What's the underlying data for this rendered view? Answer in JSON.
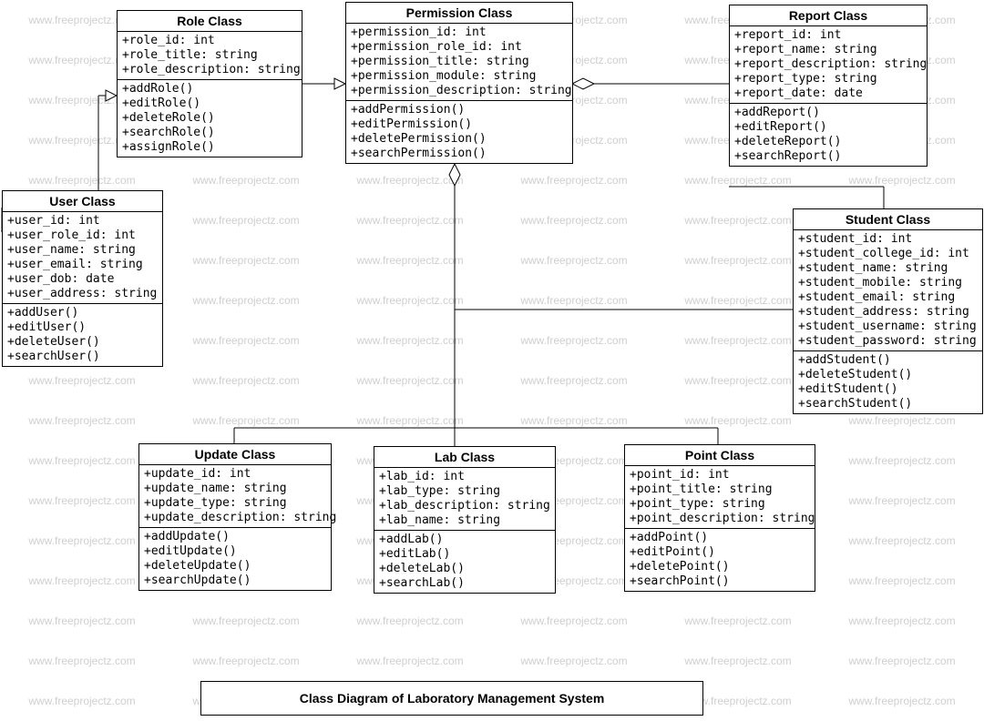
{
  "diagram_title": "Class Diagram of Laboratory Management System",
  "watermark_text": "www.freeprojectz.com",
  "classes": {
    "role": {
      "name": "Role Class",
      "attributes": [
        "+role_id: int",
        "+role_title: string",
        "+role_description: string"
      ],
      "methods": [
        "+addRole()",
        "+editRole()",
        "+deleteRole()",
        "+searchRole()",
        "+assignRole()"
      ]
    },
    "permission": {
      "name": "Permission Class",
      "attributes": [
        "+permission_id: int",
        "+permission_role_id: int",
        "+permission_title: string",
        "+permission_module: string",
        "+permission_description: string"
      ],
      "methods": [
        "+addPermission()",
        "+editPermission()",
        "+deletePermission()",
        "+searchPermission()"
      ]
    },
    "report": {
      "name": "Report Class",
      "attributes": [
        "+report_id: int",
        "+report_name: string",
        "+report_description: string",
        "+report_type: string",
        "+report_date: date"
      ],
      "methods": [
        "+addReport()",
        "+editReport()",
        "+deleteReport()",
        "+searchReport()"
      ]
    },
    "user": {
      "name": "User Class",
      "attributes": [
        "+user_id: int",
        "+user_role_id: int",
        "+user_name: string",
        "+user_email: string",
        "+user_dob: date",
        "+user_address: string"
      ],
      "methods": [
        "+addUser()",
        "+editUser()",
        "+deleteUser()",
        "+searchUser()"
      ]
    },
    "student": {
      "name": "Student Class",
      "attributes": [
        "+student_id: int",
        "+student_college_id: int",
        "+student_name: string",
        "+student_mobile: string",
        "+student_email: string",
        "+student_address: string",
        "+student_username: string",
        "+student_password: string"
      ],
      "methods": [
        "+addStudent()",
        "+deleteStudent()",
        "+editStudent()",
        "+searchStudent()"
      ]
    },
    "update": {
      "name": "Update Class",
      "attributes": [
        "+update_id: int",
        "+update_name: string",
        "+update_type: string",
        "+update_description: string"
      ],
      "methods": [
        "+addUpdate()",
        "+editUpdate()",
        "+deleteUpdate()",
        "+searchUpdate()"
      ]
    },
    "lab": {
      "name": "Lab Class",
      "attributes": [
        "+lab_id: int",
        "+lab_type: string",
        "+lab_description: string",
        "+lab_name: string"
      ],
      "methods": [
        "+addLab()",
        "+editLab()",
        "+deleteLab()",
        "+searchLab()"
      ]
    },
    "point": {
      "name": "Point Class",
      "attributes": [
        "+point_id: int",
        "+point_title: string",
        "+point_type: string",
        "+point_description: string"
      ],
      "methods": [
        "+addPoint()",
        "+editPoint()",
        "+deletePoint()",
        "+searchPoint()"
      ]
    }
  }
}
